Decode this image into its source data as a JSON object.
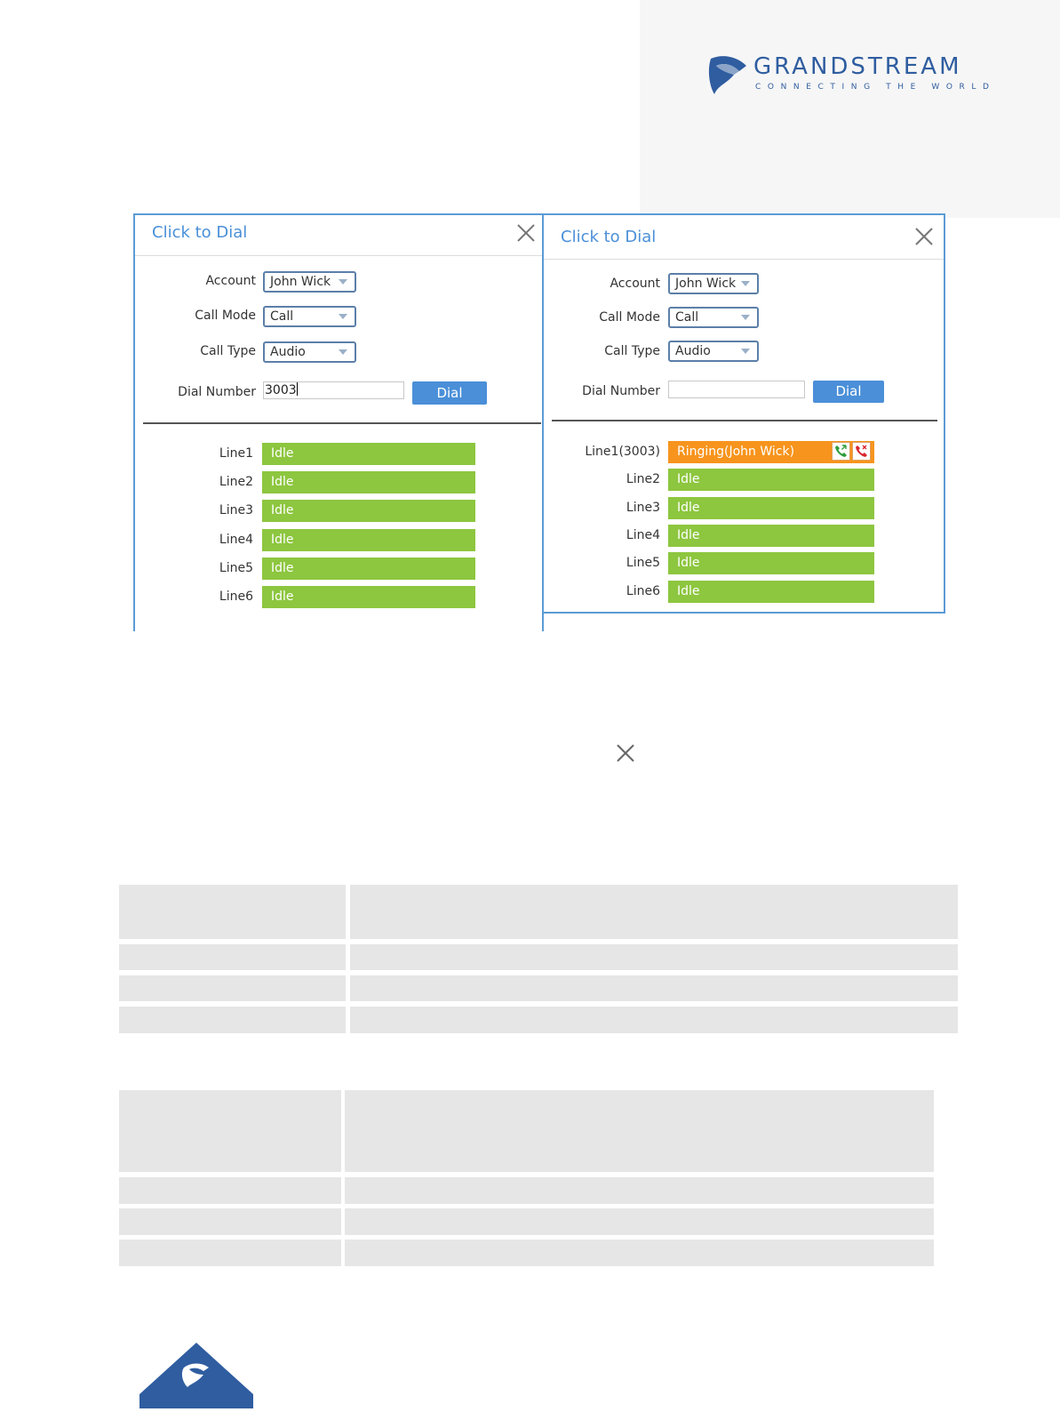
{
  "brand": {
    "name": "GRANDSTREAM",
    "tagline": "CONNECTING THE WORLD",
    "color": "#2f5da0"
  },
  "dialog_left": {
    "title": "Click to Dial",
    "account_label": "Account",
    "account_value": "John Wick",
    "call_mode_label": "Call Mode",
    "call_mode_value": "Call",
    "call_type_label": "Call Type",
    "call_type_value": "Audio",
    "dial_number_label": "Dial Number",
    "dial_number_value": "3003",
    "dial_button": "Dial",
    "lines": [
      {
        "label": "Line1",
        "status": "Idle"
      },
      {
        "label": "Line2",
        "status": "Idle"
      },
      {
        "label": "Line3",
        "status": "Idle"
      },
      {
        "label": "Line4",
        "status": "Idle"
      },
      {
        "label": "Line5",
        "status": "Idle"
      },
      {
        "label": "Line6",
        "status": "Idle"
      }
    ]
  },
  "dialog_right": {
    "title": "Click to Dial",
    "account_label": "Account",
    "account_value": "John Wick",
    "call_mode_label": "Call Mode",
    "call_mode_value": "Call",
    "call_type_label": "Call Type",
    "call_type_value": "Audio",
    "dial_number_label": "Dial Number",
    "dial_number_value": "",
    "dial_button": "Dial",
    "lines": [
      {
        "label": "Line1(3003)",
        "status": "Ringing(John Wick)"
      },
      {
        "label": "Line2",
        "status": "Idle"
      },
      {
        "label": "Line3",
        "status": "Idle"
      },
      {
        "label": "Line4",
        "status": "Idle"
      },
      {
        "label": "Line5",
        "status": "Idle"
      },
      {
        "label": "Line6",
        "status": "Idle"
      }
    ]
  },
  "icons": {
    "close": "close-icon",
    "answer": "answer-call-icon",
    "reject": "reject-call-icon",
    "logo": "grandstream-logo-icon"
  },
  "colors": {
    "idle": "#8dc63f",
    "ringing": "#f7941d",
    "accent": "#4a8fd8",
    "table_cell": "#e6e6e6"
  }
}
